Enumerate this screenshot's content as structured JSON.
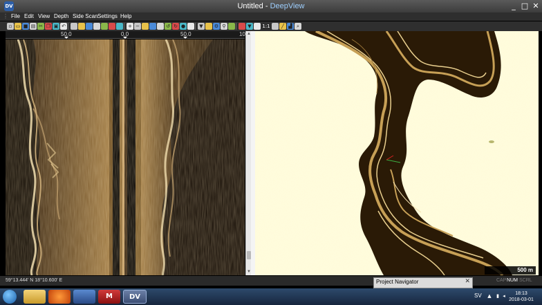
{
  "window": {
    "title_doc": "Untitled",
    "title_sep": " - ",
    "title_app": "DeepView",
    "app_icon_text": "DV",
    "controls": {
      "minimize": "_",
      "maximize": "□",
      "close": "✕"
    }
  },
  "menu": [
    "File",
    "Edit",
    "View",
    "Depth",
    "Side Scan",
    "Settings",
    "Help"
  ],
  "toolbar": {
    "icons": [
      "new-icon",
      "open-icon",
      "save-icon",
      "print-icon",
      "cut-icon",
      "copy-icon",
      "paste-icon",
      "undo-icon",
      "track-icon",
      "layer-icon",
      "grid-icon",
      "palette-icon",
      "waypoint-icon",
      "route-icon",
      "marker-icon",
      "zoom-in-icon",
      "zoom-out-icon",
      "pan-icon",
      "select-icon",
      "rectangle-icon",
      "rotate-left-icon",
      "rotate-right-icon",
      "record-icon",
      "measure-icon",
      "filter-icon",
      "contrast-icon",
      "settings-icon",
      "pin-icon",
      "gain-icon",
      "export-icon",
      "filter-down-icon",
      "panel-icon",
      "split-icon",
      "ruler-icon",
      "chart-icon",
      "zoom-icon"
    ],
    "ratio_label": "1:1"
  },
  "sonar": {
    "ruler_labels": [
      "50.0",
      "0.0",
      "50.0",
      "10"
    ],
    "colors": {
      "dark": "#1c1206",
      "mid": "#6b4a1c",
      "light": "#d9b77a",
      "bright": "#f2dfae"
    }
  },
  "map": {
    "scale_label": "500 m",
    "colors": {
      "land": "#fffbd8",
      "water_dark": "#2a1a06",
      "water_edge": "#c7a056",
      "contour": "#e9cf8e"
    }
  },
  "status": {
    "coordinates": "59°13.444' N 18°10.600' E",
    "keys": [
      "CAP",
      "NUM",
      "SCRL"
    ]
  },
  "navigator": {
    "title": "Project Navigator",
    "close": "✕"
  },
  "taskbar": {
    "apps": [
      "explorer",
      "media-player",
      "shield",
      "antivirus",
      "deepview"
    ],
    "deepview_label": "DV",
    "antivirus_label": "M",
    "language": "SV",
    "time": "18:13",
    "date": "2018-03-01"
  }
}
